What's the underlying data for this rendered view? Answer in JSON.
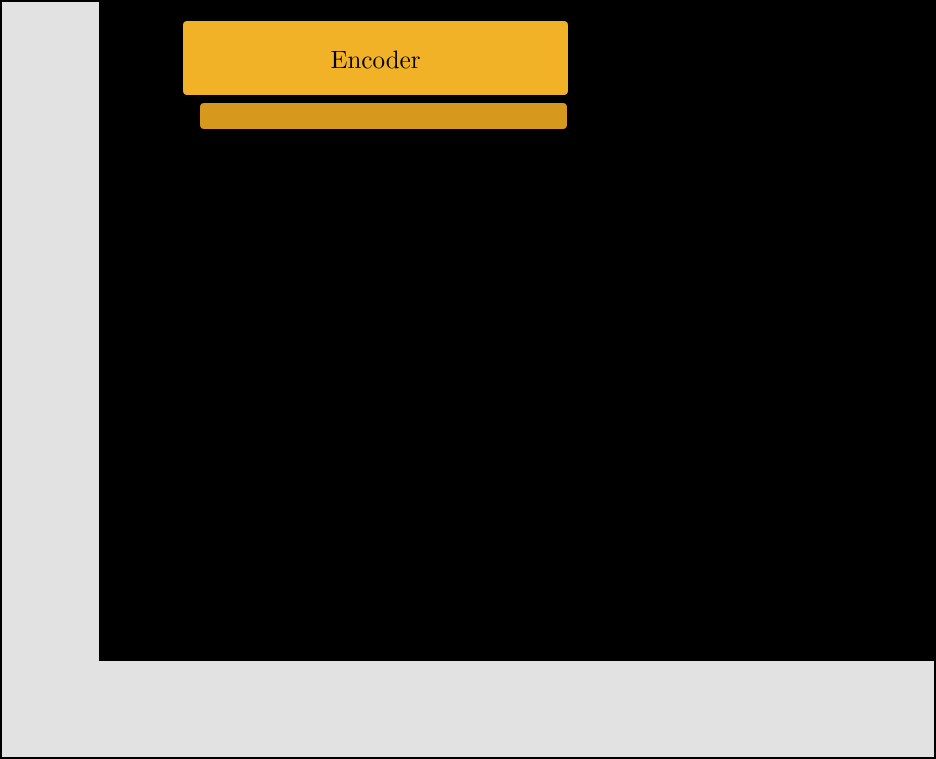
{
  "blocks": {
    "encoder": {
      "label": "Encoder",
      "colors": {
        "front": "#f1b227",
        "back": "#d6981d"
      }
    }
  },
  "canvas": {
    "outer_bg": "#e2e2e2",
    "inner_bg": "#000000",
    "border": "#000000"
  }
}
